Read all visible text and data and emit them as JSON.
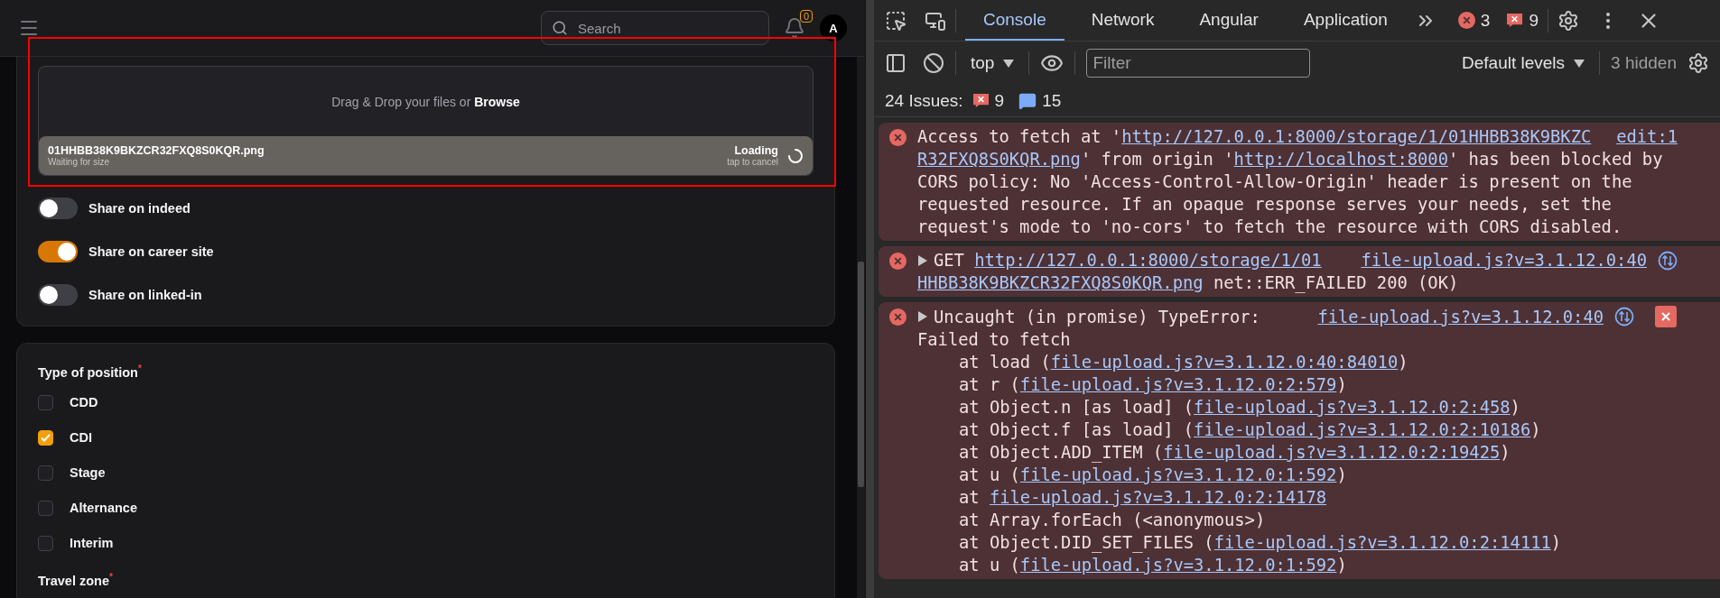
{
  "app": {
    "header": {
      "search": {
        "placeholder": "Search"
      },
      "notifications": {
        "count": "0"
      },
      "avatar": {
        "initial": "A"
      }
    },
    "upload": {
      "prompt": "Drag & Drop your files or **Browse**",
      "file": {
        "name": "01HHBB38K9BKZCR32FXQ8S0KQR.png",
        "status": "Waiting for size",
        "state": "Loading",
        "hint": "tap to cancel"
      }
    },
    "toggles": [
      {
        "label": "Share on indeed",
        "on": false
      },
      {
        "label": "Share on career site",
        "on": true
      },
      {
        "label": "Share on linked-in",
        "on": false
      }
    ],
    "position": {
      "label": "Type of position$^{*}$",
      "options": [
        {
          "label": "CDD",
          "checked": false
        },
        {
          "label": "CDI",
          "checked": true
        },
        {
          "label": "Stage",
          "checked": false
        },
        {
          "label": "Alternance",
          "checked": false
        },
        {
          "label": "Interim",
          "checked": false
        }
      ]
    },
    "next_section": {
      "label": "Travel zone$^{*}$"
    }
  },
  "devtools": {
    "tabs": [
      {
        "label": "Console",
        "selected": true
      },
      {
        "label": "Network",
        "selected": false
      },
      {
        "label": "Angular",
        "selected": false
      },
      {
        "label": "Application",
        "selected": false
      }
    ],
    "error_count": "3",
    "issue_badge_count": "9",
    "toolbar": {
      "context": "top",
      "filter_placeholder": "Filter",
      "levels": "Default levels",
      "hidden": "3 hidden"
    },
    "issues": {
      "label": "24 Issues:",
      "errors": "9",
      "infos": "15"
    },
    "messages": [
      {
        "expandable": false,
        "source": "edit:1",
        "network_icon": false,
        "explain_icon": false,
        "lines": [
          [
            {
              "kind": "text",
              "text": "Access to fetch at '"
            },
            {
              "kind": "link",
              "text": "http://127.0.0.1:8000/storage/1/01HHBB38K9BKZC"
            }
          ],
          [
            {
              "kind": "link",
              "text": "R32FXQ8S0KQR.png"
            },
            {
              "kind": "text",
              "text": "' from origin '"
            },
            {
              "kind": "link",
              "text": "http://localhost:8000"
            },
            {
              "kind": "text",
              "text": "' has been blocked by"
            }
          ],
          [
            {
              "kind": "text",
              "text": "CORS policy: No 'Access-Control-Allow-Origin' header is present on the"
            }
          ],
          [
            {
              "kind": "text",
              "text": "requested resource. If an opaque response serves your needs, set the"
            }
          ],
          [
            {
              "kind": "text",
              "text": "request's mode to 'no-cors' to fetch the resource with CORS disabled."
            }
          ]
        ]
      },
      {
        "expandable": true,
        "source": "file-upload.js?v=3.1.12.0:40",
        "network_icon": true,
        "explain_icon": false,
        "lines": [
          [
            {
              "kind": "text",
              "text": "GET "
            },
            {
              "kind": "link",
              "text": "http://127.0.0.1:8000/storage/1/01"
            }
          ],
          [
            {
              "kind": "link",
              "text": "HHBB38K9BKZCR32FXQ8S0KQR.png"
            },
            {
              "kind": "text",
              "text": " net::ERR_FAILED 200 (OK)"
            }
          ]
        ]
      },
      {
        "expandable": true,
        "source": "file-upload.js?v=3.1.12.0:40",
        "network_icon": true,
        "explain_icon": true,
        "lines": [
          [
            {
              "kind": "text",
              "text": "Uncaught (in promise) TypeError:"
            }
          ],
          [
            {
              "kind": "text",
              "text": "Failed to fetch"
            }
          ]
        ],
        "stack": [
          [
            {
              "kind": "text",
              "text": "at load ("
            },
            {
              "kind": "link",
              "text": "file-upload.js?v=3.1.12.0:40:84010"
            },
            {
              "kind": "text",
              "text": ")"
            }
          ],
          [
            {
              "kind": "text",
              "text": "at r ("
            },
            {
              "kind": "link",
              "text": "file-upload.js?v=3.1.12.0:2:579"
            },
            {
              "kind": "text",
              "text": ")"
            }
          ],
          [
            {
              "kind": "text",
              "text": "at Object.n [as load] ("
            },
            {
              "kind": "link",
              "text": "file-upload.js?v=3.1.12.0:2:458"
            },
            {
              "kind": "text",
              "text": ")"
            }
          ],
          [
            {
              "kind": "text",
              "text": "at Object.f [as load] ("
            },
            {
              "kind": "link",
              "text": "file-upload.js?v=3.1.12.0:2:10186"
            },
            {
              "kind": "text",
              "text": ")"
            }
          ],
          [
            {
              "kind": "text",
              "text": "at Object.ADD_ITEM ("
            },
            {
              "kind": "link",
              "text": "file-upload.js?v=3.1.12.0:2:19425"
            },
            {
              "kind": "text",
              "text": ")"
            }
          ],
          [
            {
              "kind": "text",
              "text": "at u ("
            },
            {
              "kind": "link",
              "text": "file-upload.js?v=3.1.12.0:1:592"
            },
            {
              "kind": "text",
              "text": ")"
            }
          ],
          [
            {
              "kind": "text",
              "text": "at "
            },
            {
              "kind": "link",
              "text": "file-upload.js?v=3.1.12.0:2:14178"
            }
          ],
          [
            {
              "kind": "text",
              "text": "at Array.forEach (<anonymous>)"
            }
          ],
          [
            {
              "kind": "text",
              "text": "at Object.DID_SET_FILES ("
            },
            {
              "kind": "link",
              "text": "file-upload.js?v=3.1.12.0:2:14111"
            },
            {
              "kind": "text",
              "text": ")"
            }
          ],
          [
            {
              "kind": "text",
              "text": "at u ("
            },
            {
              "kind": "link",
              "text": "file-upload.js?v=3.1.12.0:1:592"
            },
            {
              "kind": "text",
              "text": ")"
            }
          ]
        ]
      }
    ]
  }
}
